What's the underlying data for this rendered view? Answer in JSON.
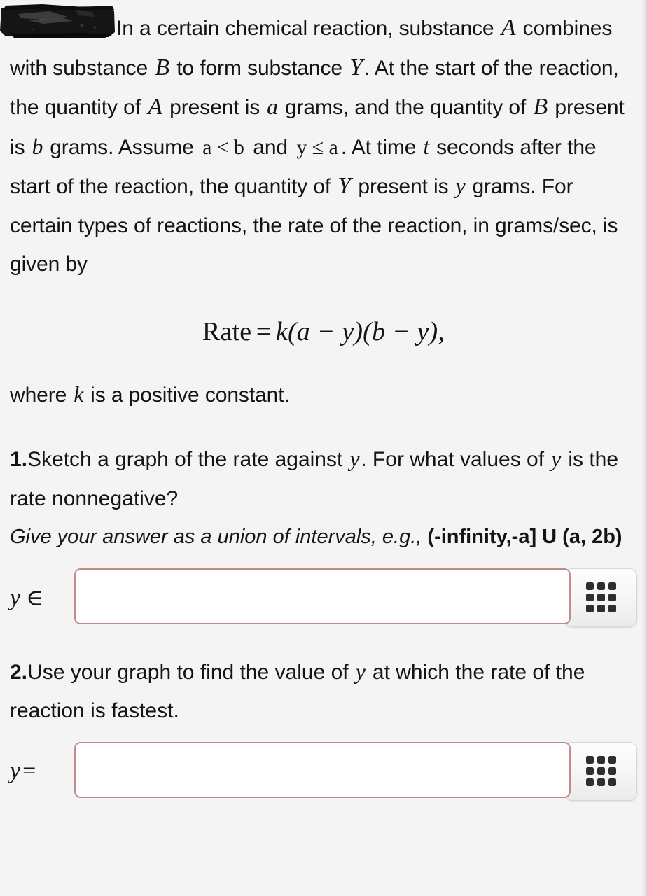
{
  "page": {
    "background_color": "#f4f4f4",
    "text_color": "#141414"
  },
  "problem": {
    "redaction": "black-scribble-redaction",
    "paragraph_segments": [
      {
        "kind": "text",
        "value": "In a certain chemical reaction, substance "
      },
      {
        "kind": "math",
        "value": "A"
      },
      {
        "kind": "text",
        "value": " combines with substance "
      },
      {
        "kind": "math",
        "value": "B"
      },
      {
        "kind": "text",
        "value": " to form substance "
      },
      {
        "kind": "math",
        "value": "Y"
      },
      {
        "kind": "text",
        "value": ". At the start of the reaction, the quantity of "
      },
      {
        "kind": "math",
        "value": "A"
      },
      {
        "kind": "text",
        "value": " present is "
      },
      {
        "kind": "math",
        "value": "a"
      },
      {
        "kind": "text",
        "value": " grams, and the quantity of "
      },
      {
        "kind": "math",
        "value": "B"
      },
      {
        "kind": "text",
        "value": " present is "
      },
      {
        "kind": "math",
        "value": "b"
      },
      {
        "kind": "text",
        "value": " grams. Assume "
      },
      {
        "kind": "math",
        "value": "a < b"
      },
      {
        "kind": "text",
        "value": " and "
      },
      {
        "kind": "math",
        "value": "y ≤ a"
      },
      {
        "kind": "text",
        "value": ". At time "
      },
      {
        "kind": "math",
        "value": "t"
      },
      {
        "kind": "text",
        "value": " seconds after the start of the reaction, the quantity of "
      },
      {
        "kind": "math",
        "value": "Y"
      },
      {
        "kind": "text",
        "value": " present is "
      },
      {
        "kind": "math",
        "value": "y"
      },
      {
        "kind": "text",
        "value": " grams. For certain types of reactions, the rate of the reaction, in grams/sec, is given by"
      }
    ],
    "paragraph_plain": "In a certain chemical reaction, substance A combines with substance B to form substance Y. At the start of the reaction, the quantity of A present is a grams, and the quantity of B present is b grams. Assume a < b and y ≤ a. At time t seconds after the start of the reaction, the quantity of Y present is y grams. For certain types of reactions, the rate of the reaction, in grams/sec, is given by",
    "equation": {
      "lhs": "Rate",
      "relation": "=",
      "rhs": "k(a − y)(b − y),",
      "full": "Rate = k(a − y)(b − y),"
    },
    "where_line": {
      "prefix": "where ",
      "variable": "k",
      "suffix": " is a positive constant."
    }
  },
  "questions": [
    {
      "number": "1.",
      "prompt_part_1": "Sketch a graph of the rate against ",
      "prompt_var": "y",
      "prompt_part_2": ". For what values of ",
      "prompt_var_2": "y",
      "prompt_part_3": " is the rate nonnegative?",
      "prompt_plain": "1. Sketch a graph of the rate against y. For what values of y is the rate nonnegative?",
      "hint_italic": "Give your answer as a union of intervals, e.g., ",
      "hint_bold": "(-infinity,-a] U (a, 2b)",
      "answer": {
        "label_var": "y",
        "label_symbol": "∈",
        "value": "",
        "placeholder": "",
        "border_color": "#c08b8b"
      },
      "keypad_button": {
        "icon": "keypad-grid-icon",
        "dot_count": 9,
        "aria_label": "Open math keypad"
      }
    },
    {
      "number": "2.",
      "prompt_part_1": "Use your graph to find the value of ",
      "prompt_var": "y",
      "prompt_part_2": " at which the rate of the reaction is fastest.",
      "prompt_plain": "2. Use your graph to find the value of y at which the rate of the reaction is fastest.",
      "answer": {
        "label_var": "y",
        "label_symbol": "=",
        "value": "",
        "placeholder": "",
        "border_color": "#c08b8b"
      },
      "keypad_button": {
        "icon": "keypad-grid-icon",
        "dot_count": 9,
        "aria_label": "Open math keypad"
      }
    }
  ]
}
